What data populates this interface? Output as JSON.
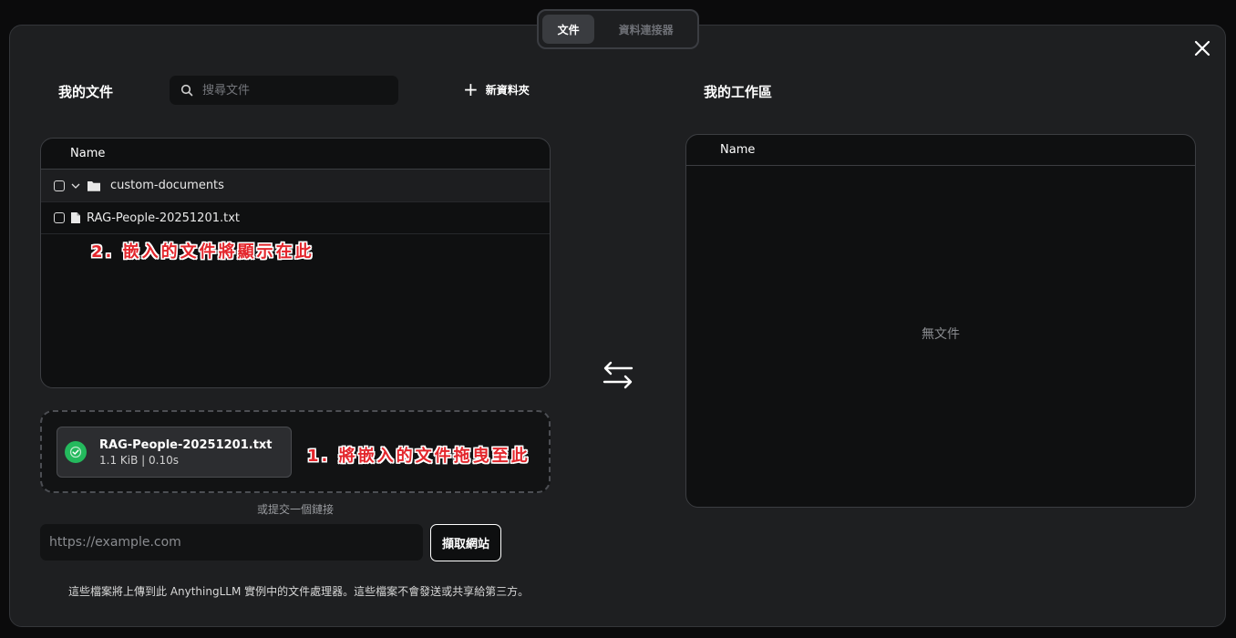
{
  "tabs": {
    "documents": "文件",
    "data_connectors": "資料連接器"
  },
  "left_panel": {
    "title": "我的文件",
    "search_placeholder": "搜尋文件",
    "new_folder_label": "新資料夾",
    "table_header": "Name",
    "items": [
      {
        "type": "folder",
        "name": "custom-documents"
      },
      {
        "type": "file",
        "name": "RAG-People-20251201.txt"
      }
    ]
  },
  "annotations": {
    "embedded_note": "2. 嵌入的文件將顯示在此",
    "drag_note": "1. 將嵌入的文件拖曳至此"
  },
  "upload": {
    "file_name": "RAG-People-20251201.txt",
    "file_info": "1.1 KiB | 0.10s"
  },
  "link": {
    "label": "或提交一個鏈接",
    "placeholder": "https://example.com",
    "fetch_button": "擷取網站"
  },
  "footnote": "這些檔案將上傳到此 AnythingLLM 實例中的文件處理器。這些檔案不會發送或共享給第三方。",
  "right_panel": {
    "title": "我的工作區",
    "table_header": "Name",
    "empty_text": "無文件"
  },
  "colors": {
    "success": "#24b95d",
    "annotation": "#e3262c"
  }
}
